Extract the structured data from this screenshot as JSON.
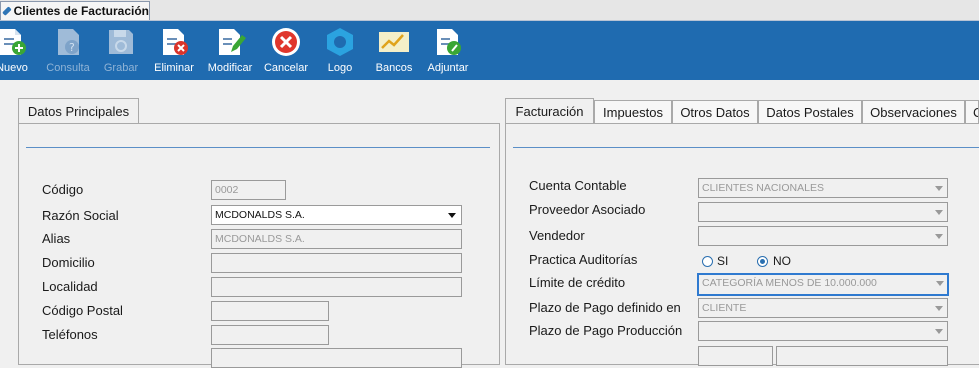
{
  "window_tab": {
    "title": "Clientes de Facturación"
  },
  "toolbar": {
    "buttons": [
      {
        "label": "Nuevo",
        "icon": "new-document-icon",
        "enabled": true
      },
      {
        "label": "Consulta",
        "icon": "query-document-icon",
        "enabled": false
      },
      {
        "label": "Grabar",
        "icon": "save-disk-icon",
        "enabled": false
      },
      {
        "label": "Eliminar",
        "icon": "delete-document-icon",
        "enabled": true
      },
      {
        "label": "Modificar",
        "icon": "edit-document-icon",
        "enabled": true
      },
      {
        "label": "Cancelar",
        "icon": "cancel-icon",
        "enabled": true
      },
      {
        "label": "Logo",
        "icon": "logo-icon",
        "enabled": true
      },
      {
        "label": "Bancos",
        "icon": "banks-chart-icon",
        "enabled": true
      },
      {
        "label": "Adjuntar",
        "icon": "attach-document-icon",
        "enabled": true
      }
    ]
  },
  "left_panel": {
    "tab": "Datos Principales",
    "fields": {
      "codigo": {
        "label": "Código",
        "value": "0002"
      },
      "razon_social": {
        "label": "Razón Social",
        "value": "MCDONALDS S.A."
      },
      "alias": {
        "label": "Alias",
        "value": "MCDONALDS S.A."
      },
      "domicilio": {
        "label": "Domicilio",
        "value": ""
      },
      "localidad": {
        "label": "Localidad",
        "value": ""
      },
      "codigo_postal": {
        "label": "Código Postal",
        "value": ""
      },
      "telefonos": {
        "label": "Teléfonos",
        "value": ""
      }
    }
  },
  "right_panel": {
    "tabs": [
      "Facturación",
      "Impuestos",
      "Otros Datos",
      "Datos Postales",
      "Observaciones",
      "C"
    ],
    "active_tab": "Facturación",
    "fields": {
      "cuenta_contable": {
        "label": "Cuenta Contable",
        "value": "CLIENTES NACIONALES"
      },
      "proveedor_asociado": {
        "label": "Proveedor Asociado",
        "value": ""
      },
      "vendedor": {
        "label": "Vendedor",
        "value": ""
      },
      "practica_auditorias": {
        "label": "Practica Auditorías",
        "options": [
          "SI",
          "NO"
        ],
        "selected": "NO"
      },
      "limite_credito": {
        "label": "Límite de crédito",
        "value": "CATEGORÍA MENOS DE 10.000.000"
      },
      "plazo_pago_definido": {
        "label": "Plazo de Pago definido en",
        "value": "CLIENTE"
      },
      "plazo_pago_produccion": {
        "label": "Plazo de Pago Producción",
        "value": ""
      }
    }
  },
  "colors": {
    "toolbar": "#1f6bb0",
    "focus_border": "#2f7ad0",
    "separator": "#5b8fc7"
  }
}
